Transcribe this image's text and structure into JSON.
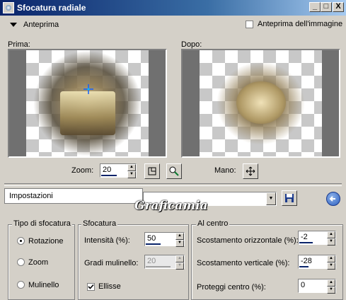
{
  "window": {
    "title": "Sfocatura radiale",
    "buttons": [
      "_",
      "□",
      "X"
    ]
  },
  "preview": {
    "toggle_label": "Anteprima",
    "image_preview_checkbox": {
      "label": "Anteprima dell'immagine",
      "checked": false
    },
    "before_label": "Prima:",
    "after_label": "Dopo:"
  },
  "zoom": {
    "label": "Zoom:",
    "value": "20",
    "pan_label": "Mano:"
  },
  "settings": {
    "label": "Impostazioni",
    "preset_value": "",
    "watermark": "Graficamia"
  },
  "blur_type": {
    "title": "Tipo di sfocatura",
    "options": [
      {
        "label": "Rotazione",
        "selected": true
      },
      {
        "label": "Zoom",
        "selected": false
      },
      {
        "label": "Mulinello",
        "selected": false
      }
    ]
  },
  "blur": {
    "title": "Sfocatura",
    "intensity": {
      "label": "Intensità (%):",
      "value": "50"
    },
    "twist": {
      "label": "Gradi mulinello:",
      "value": "20",
      "disabled": true
    },
    "ellipse": {
      "label": "Ellisse",
      "checked": true
    }
  },
  "center": {
    "title": "Al centro",
    "h_offset": {
      "label": "Scostamento orizzontale (%):",
      "value": "-2"
    },
    "v_offset": {
      "label": "Scostamento verticale (%):",
      "value": "-28"
    },
    "protect": {
      "label": "Proteggi centro (%):",
      "value": "0"
    }
  },
  "colors": {
    "titlebar_start": "#0a246a",
    "titlebar_end": "#a6caf0",
    "face": "#d4d0c8"
  },
  "icons": [
    "app-icon",
    "triangle-down-icon",
    "crosshair-icon",
    "zoom-fit-icon",
    "zoom-magnifier-icon",
    "move-pan-icon",
    "save-disk-icon",
    "reset-arrow-icon"
  ]
}
